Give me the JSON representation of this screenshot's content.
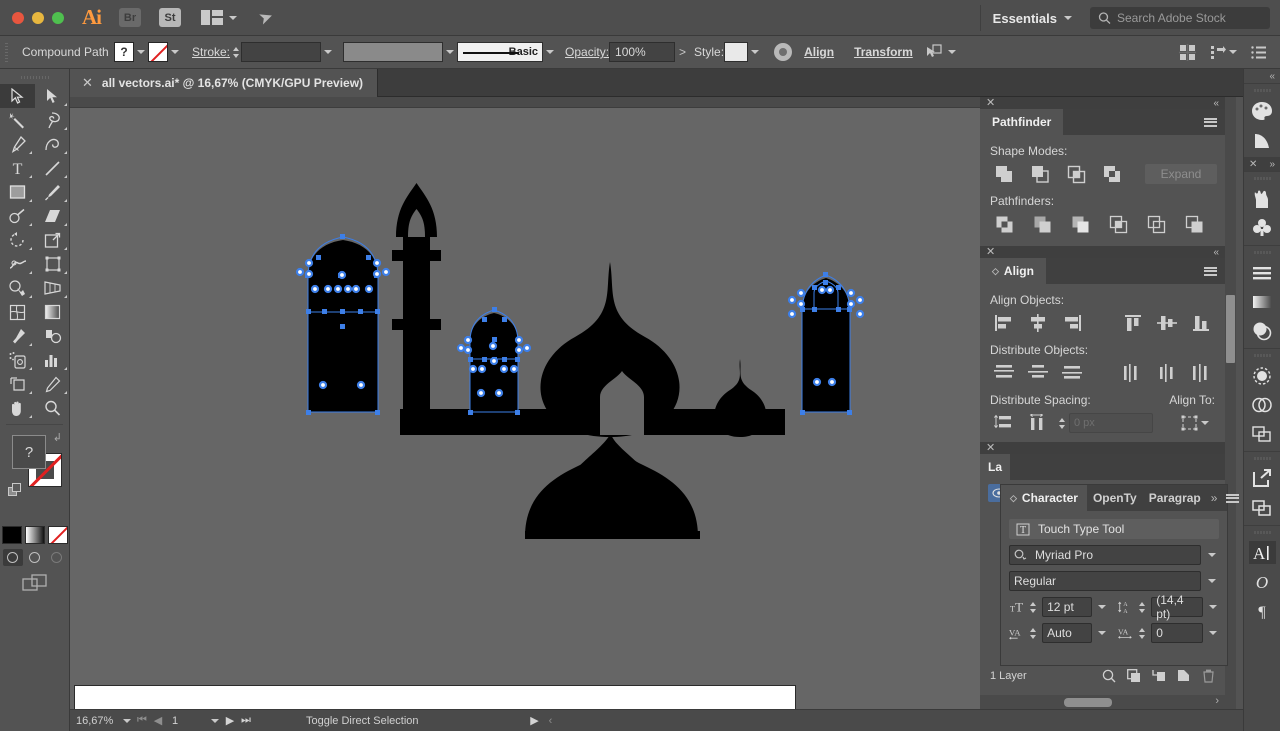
{
  "titlebar": {
    "app_name": "Ai",
    "bridge_label": "Br",
    "stock_label": "St",
    "workspace": "Essentials",
    "search_placeholder": "Search Adobe Stock",
    "icons": [
      "close-dot",
      "minimize-dot",
      "zoom-dot",
      "arrange-documents-icon",
      "rocket-icon",
      "chevron-down-icon",
      "search-icon"
    ]
  },
  "controlbar": {
    "object_type": "Compound Path",
    "fill_label": "?",
    "stroke_label": "Stroke:",
    "stroke_weight": "",
    "profile_label": "Basic",
    "opacity_label": "Opacity:",
    "opacity_value": "100%",
    "style_label": "Style:",
    "align_label": "Align",
    "transform_label": "Transform",
    "arrow_label": ">"
  },
  "tabbar": {
    "document_title": "all vectors.ai* @ 16,67% (CMYK/GPU Preview)",
    "close_glyph": "✕"
  },
  "toolbar": {
    "tools": [
      {
        "name": "selection-tool",
        "selected": true
      },
      {
        "name": "direct-selection-tool",
        "selected": false
      },
      {
        "name": "magic-wand-tool",
        "selected": false
      },
      {
        "name": "lasso-tool",
        "selected": false
      },
      {
        "name": "pen-tool",
        "selected": false
      },
      {
        "name": "curvature-tool",
        "selected": false
      },
      {
        "name": "type-tool",
        "selected": false
      },
      {
        "name": "line-segment-tool",
        "selected": false
      },
      {
        "name": "rectangle-tool",
        "selected": false
      },
      {
        "name": "paintbrush-tool",
        "selected": false
      },
      {
        "name": "shaper-tool",
        "selected": false
      },
      {
        "name": "eraser-tool",
        "selected": false
      },
      {
        "name": "rotate-tool",
        "selected": false
      },
      {
        "name": "scale-tool",
        "selected": false
      },
      {
        "name": "width-tool",
        "selected": false
      },
      {
        "name": "free-transform-tool",
        "selected": false
      },
      {
        "name": "shape-builder-tool",
        "selected": false
      },
      {
        "name": "perspective-grid-tool",
        "selected": false
      },
      {
        "name": "mesh-tool",
        "selected": false
      },
      {
        "name": "gradient-tool",
        "selected": false
      },
      {
        "name": "eyedropper-tool",
        "selected": false
      },
      {
        "name": "blend-tool",
        "selected": false
      },
      {
        "name": "symbol-sprayer-tool",
        "selected": false
      },
      {
        "name": "column-graph-tool",
        "selected": false
      },
      {
        "name": "artboard-tool",
        "selected": false
      },
      {
        "name": "slice-tool",
        "selected": false
      },
      {
        "name": "hand-tool",
        "selected": false
      },
      {
        "name": "zoom-tool",
        "selected": false
      }
    ],
    "fill_value": "?",
    "stroke_value": "none",
    "color_modes": [
      "color-swatch",
      "gradient-swatch",
      "none-swatch"
    ],
    "draw_modes": [
      "draw-normal",
      "draw-behind",
      "draw-inside"
    ],
    "screen_mode": "change-screen-mode"
  },
  "pathfinder": {
    "title": "Pathfinder",
    "shape_modes_label": "Shape Modes:",
    "shape_modes": [
      "unite-icon",
      "minus-front-icon",
      "intersect-icon",
      "exclude-icon"
    ],
    "expand_label": "Expand",
    "pathfinders_label": "Pathfinders:",
    "pathfinders": [
      "divide-icon",
      "trim-icon",
      "merge-icon",
      "crop-icon",
      "outline-icon",
      "minus-back-icon"
    ]
  },
  "align": {
    "title": "Align",
    "align_objects_label": "Align Objects:",
    "align_objects": [
      "align-left-icon",
      "align-horizontal-center-icon",
      "align-right-icon",
      "align-top-icon",
      "align-vertical-center-icon",
      "align-bottom-icon"
    ],
    "distribute_objects_label": "Distribute Objects:",
    "distribute_objects": [
      "distribute-vertical-top-icon",
      "distribute-vertical-center-icon",
      "distribute-vertical-bottom-icon",
      "distribute-horizontal-left-icon",
      "distribute-horizontal-center-icon",
      "distribute-horizontal-right-icon"
    ],
    "distribute_spacing_label": "Distribute Spacing:",
    "distribute_spacing": [
      "distribute-vertical-space-icon",
      "distribute-horizontal-space-icon"
    ],
    "spacing_value": "0 px",
    "align_to_label": "Align To:",
    "align_to_icon": "align-to-selection-icon"
  },
  "character": {
    "tabs": [
      {
        "label": "Character",
        "active": true
      },
      {
        "label": "OpenTy",
        "active": false
      },
      {
        "label": "Paragrap",
        "active": false
      }
    ],
    "more_glyph": "»",
    "touch_type_label": "Touch Type Tool",
    "font_family": "Myriad Pro",
    "font_style": "Regular",
    "font_size": "12 pt",
    "leading": "(14,4 pt)",
    "kerning": "Auto",
    "tracking": "0"
  },
  "layers": {
    "tab_label": "La",
    "count_label": "1 Layer",
    "buttons": [
      "locate-object-icon",
      "make-clipping-mask-icon",
      "create-new-sublayer-icon",
      "create-new-layer-icon",
      "delete-selection-icon"
    ]
  },
  "statusbar": {
    "zoom_level": "16,67%",
    "page_number": "1",
    "status_text": "Toggle Direct Selection",
    "nav_icons": [
      "first-page-icon",
      "previous-page-icon",
      "next-page-icon",
      "last-page-icon"
    ]
  },
  "dock": {
    "collapse_glyph": "«",
    "groups": [
      {
        "icons": [
          "color-panel-icon",
          "color-guide-panel-icon"
        ]
      },
      {
        "icons": [
          "brushes-panel-icon",
          "symbols-panel-icon"
        ],
        "closable": true
      },
      {
        "icons": [
          "stroke-panel-icon",
          "gradient-panel-icon",
          "transparency-panel-icon"
        ]
      },
      {
        "icons": [
          "appearance-panel-icon",
          "graphic-styles-panel-icon",
          "layers-panel-icon"
        ]
      },
      {
        "icons": [
          "export-panel-icon",
          "artboards-panel-icon"
        ]
      },
      {
        "icons": [
          "character-panel-icon",
          "opentype-panel-icon",
          "paragraph-panel-icon"
        ],
        "selected_index": 0
      }
    ]
  },
  "artwork": {
    "description": "mosque silhouette vector artwork with selected compound paths",
    "selection_color": "#3d7fe8",
    "fill_color": "#000000",
    "canvas_color": "#666666",
    "artboard_color": "#ffffff"
  }
}
